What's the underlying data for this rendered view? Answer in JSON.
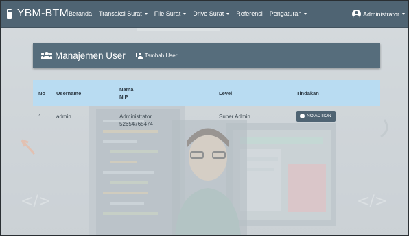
{
  "app": {
    "brand": "YBM-BTM"
  },
  "nav": {
    "items": [
      {
        "label": "Beranda",
        "dropdown": false
      },
      {
        "label": "Transaksi Surat",
        "dropdown": true
      },
      {
        "label": "File Surat",
        "dropdown": true
      },
      {
        "label": "Drive Surat",
        "dropdown": true
      },
      {
        "label": "Referensi",
        "dropdown": false
      },
      {
        "label": "Pengaturan",
        "dropdown": true
      }
    ],
    "user": "Administrator"
  },
  "panel": {
    "title": "Manajemen User",
    "add_label": "Tambah User"
  },
  "table": {
    "headers": {
      "no": "No",
      "username": "Username",
      "name_line1": "Nama",
      "name_line2": "NIP",
      "level": "Level",
      "action": "Tindakan"
    },
    "rows": [
      {
        "no": "1",
        "username": "admin",
        "name": "Administrator",
        "nip": "52654765474",
        "level": "Super Admin",
        "action": "NO ACTION"
      }
    ]
  },
  "background": {
    "code_left": "</>",
    "code_right": "</>"
  },
  "colors": {
    "navbar": "#4f6473",
    "panel_header": "#566d7c",
    "table_header": "#b9dcf2",
    "action_button": "#4f6473"
  },
  "icons": {
    "brand": "document-icon",
    "user": "account-circle-icon",
    "panel": "users-group-icon",
    "add": "add-user-icon",
    "action": "minus-circle-icon"
  }
}
